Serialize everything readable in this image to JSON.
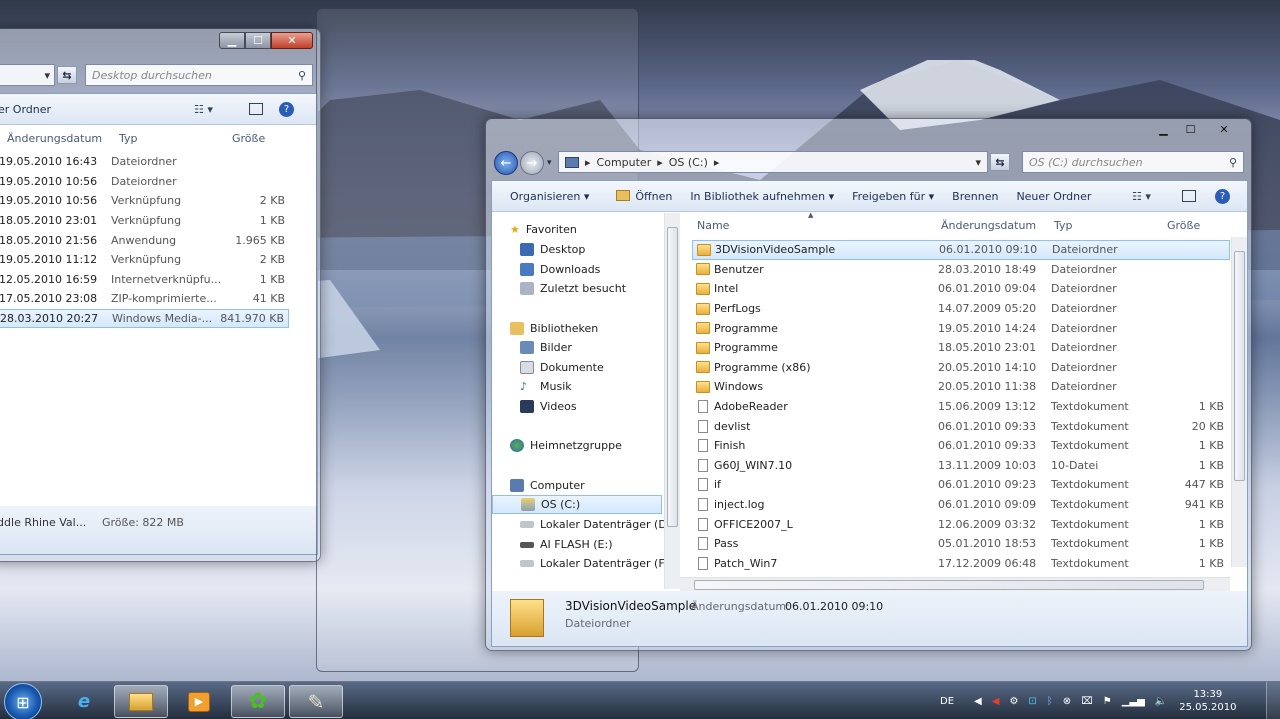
{
  "win_left": {
    "search_placeholder": "Desktop durchsuchen",
    "cmd_new_folder": "er Ordner",
    "columns": [
      "Änderungsdatum",
      "Typ",
      "Größe"
    ],
    "rows": [
      {
        "date": "19.05.2010 16:43",
        "type": "Dateiordner",
        "size": ""
      },
      {
        "date": "19.05.2010 10:56",
        "type": "Dateiordner",
        "size": ""
      },
      {
        "date": "19.05.2010 10:56",
        "type": "Verknüpfung",
        "size": "2 KB"
      },
      {
        "date": "18.05.2010 23:01",
        "type": "Verknüpfung",
        "size": "1 KB"
      },
      {
        "date": "18.05.2010 21:56",
        "type": "Anwendung",
        "size": "1.965 KB"
      },
      {
        "date": "19.05.2010 11:12",
        "type": "Verknüpfung",
        "size": "2 KB"
      },
      {
        "date": "12.05.2010 16:59",
        "type": "Internetverknüpfu...",
        "size": "1 KB"
      },
      {
        "date": "17.05.2010 23:08",
        "type": "ZIP-komprimierte...",
        "size": "41 KB"
      },
      {
        "date": "28.03.2010 20:27",
        "type": "Windows Media-...",
        "size": "841.970 KB"
      }
    ],
    "status_name": "iddle Rhine Val...",
    "status_size": "Größe: 822 MB"
  },
  "win_main": {
    "breadcrumb": [
      "Computer",
      "OS (C:)"
    ],
    "search_placeholder": "OS (C:) durchsuchen",
    "toolbar": {
      "organize": "Organisieren",
      "open": "Öffnen",
      "library": "In Bibliothek aufnehmen",
      "share": "Freigeben für",
      "burn": "Brennen",
      "new_folder": "Neuer Ordner"
    },
    "nav": {
      "favorites": "Favoriten",
      "desktop": "Desktop",
      "downloads": "Downloads",
      "recent": "Zuletzt besucht",
      "libraries": "Bibliotheken",
      "pictures": "Bilder",
      "documents": "Dokumente",
      "music": "Musik",
      "videos": "Videos",
      "homegroup": "Heimnetzgruppe",
      "computer": "Computer",
      "os": "OS (C:)",
      "local_d": "Lokaler Datenträger (D:)",
      "flash": "AI FLASH (E:)",
      "local_f": "Lokaler Datenträger (F:)"
    },
    "columns": {
      "name": "Name",
      "date": "Änderungsdatum",
      "type": "Typ",
      "size": "Größe"
    },
    "files": [
      {
        "name": "3DVisionVideoSample",
        "date": "06.01.2010 09:10",
        "type": "Dateiordner",
        "size": "",
        "kind": "folder"
      },
      {
        "name": "Benutzer",
        "date": "28.03.2010 18:49",
        "type": "Dateiordner",
        "size": "",
        "kind": "folder"
      },
      {
        "name": "Intel",
        "date": "06.01.2010 09:04",
        "type": "Dateiordner",
        "size": "",
        "kind": "folder"
      },
      {
        "name": "PerfLogs",
        "date": "14.07.2009 05:20",
        "type": "Dateiordner",
        "size": "",
        "kind": "folder"
      },
      {
        "name": "Programme",
        "date": "19.05.2010 14:24",
        "type": "Dateiordner",
        "size": "",
        "kind": "folder"
      },
      {
        "name": "Programme",
        "date": "18.05.2010 23:01",
        "type": "Dateiordner",
        "size": "",
        "kind": "folder"
      },
      {
        "name": "Programme (x86)",
        "date": "20.05.2010 14:10",
        "type": "Dateiordner",
        "size": "",
        "kind": "folder"
      },
      {
        "name": "Windows",
        "date": "20.05.2010 11:38",
        "type": "Dateiordner",
        "size": "",
        "kind": "folder"
      },
      {
        "name": "AdobeReader",
        "date": "15.06.2009 13:12",
        "type": "Textdokument",
        "size": "1 KB",
        "kind": "doc"
      },
      {
        "name": "devlist",
        "date": "06.01.2010 09:33",
        "type": "Textdokument",
        "size": "20 KB",
        "kind": "doc"
      },
      {
        "name": "Finish",
        "date": "06.01.2010 09:33",
        "type": "Textdokument",
        "size": "1 KB",
        "kind": "doc"
      },
      {
        "name": "G60J_WIN7.10",
        "date": "13.11.2009 10:03",
        "type": "10-Datei",
        "size": "1 KB",
        "kind": "doc"
      },
      {
        "name": "if",
        "date": "06.01.2010 09:23",
        "type": "Textdokument",
        "size": "447 KB",
        "kind": "doc"
      },
      {
        "name": "inject.log",
        "date": "06.01.2010 09:09",
        "type": "Textdokument",
        "size": "941 KB",
        "kind": "doc"
      },
      {
        "name": "OFFICE2007_L",
        "date": "12.06.2009 03:32",
        "type": "Textdokument",
        "size": "1 KB",
        "kind": "doc"
      },
      {
        "name": "Pass",
        "date": "05.01.2010 18:53",
        "type": "Textdokument",
        "size": "1 KB",
        "kind": "doc"
      },
      {
        "name": "Patch_Win7",
        "date": "17.12.2009 06:48",
        "type": "Textdokument",
        "size": "1 KB",
        "kind": "doc"
      }
    ],
    "details": {
      "name": "3DVisionVideoSample",
      "date_label": "Änderungsdatum:",
      "date": "06.01.2010 09:10",
      "type": "Dateiordner"
    }
  },
  "taskbar": {
    "lang": "DE",
    "time": "13:39",
    "date": "25.05.2010"
  },
  "colors": {
    "selection": "#d4e8fc",
    "accent": "#1e3050"
  }
}
